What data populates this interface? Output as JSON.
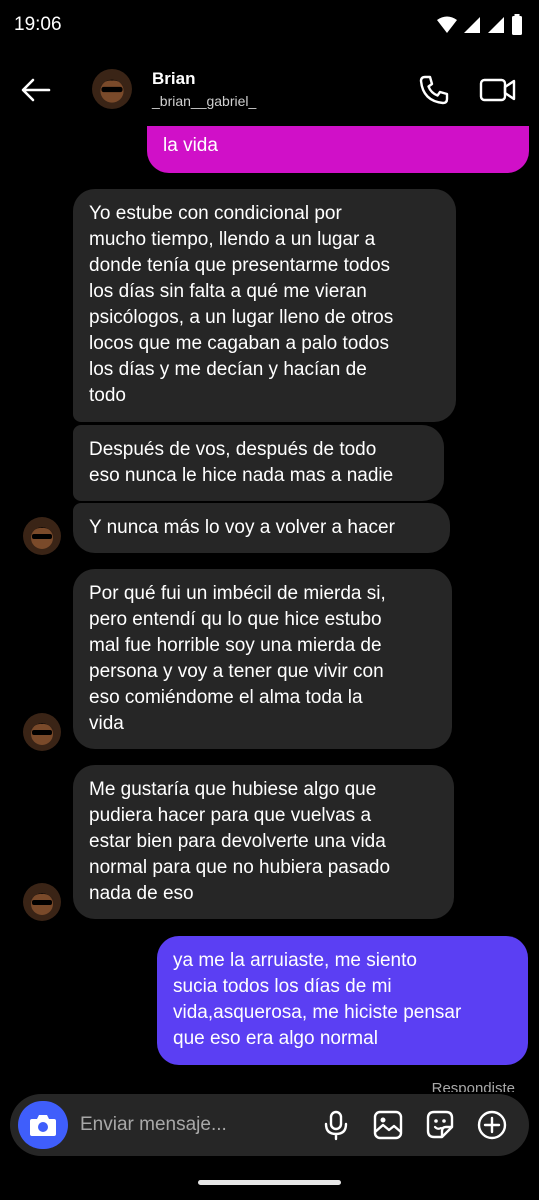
{
  "status_bar": {
    "time": "19:06"
  },
  "header": {
    "name": "Brian",
    "username": "_brian__gabriel_"
  },
  "messages": [
    {
      "id": "m0",
      "direction": "out",
      "text": "en una carcel cuando me traumaste\nla vida",
      "color": "#d010c8"
    },
    {
      "id": "m1",
      "direction": "in",
      "text": "Yo estube con condicional por\nmucho tiempo, llendo a un lugar a\ndonde tenía que presentarme todos\nlos días sin falta a qué me vieran\npsicólogos, a un lugar lleno de otros\nlocos que me cagaban a palo todos\nlos días y me decían y hacían de\ntodo"
    },
    {
      "id": "m2",
      "direction": "in",
      "text": "Después de vos, después de todo\neso nunca le hice nada mas a nadie"
    },
    {
      "id": "m3",
      "direction": "in",
      "text": "Y nunca más lo voy a volver a hacer"
    },
    {
      "id": "m4",
      "direction": "in",
      "text": "Por qué fui un imbécil de mierda si,\npero entendí qu lo que hice estubo\nmal fue horrible soy una mierda de\npersona y voy a tener que vivir con\neso comiéndome el alma toda la\nvida"
    },
    {
      "id": "m5",
      "direction": "in",
      "text": "Me gustaría que hubiese algo que\npudiera hacer para que vuelvas a\nestar bien para devolverte una vida\nnormal para que no hubiera pasado\nnada de eso"
    },
    {
      "id": "m6",
      "direction": "out",
      "text": "ya me la arruiaste, me siento\nsucia todos los días de mi\nvida,asquerosa,  me hiciste pensar\nque eso era algo normal",
      "color": "#5b3ff3"
    }
  ],
  "reply_label": "Respondiste",
  "composer": {
    "placeholder": "Enviar mensaje..."
  },
  "colors": {
    "incoming_bubble": "#262626",
    "outgoing_top": "#d010c8",
    "outgoing_bottom": "#5b3ff3",
    "camera_button": "#3f5efb"
  },
  "icons": [
    "back-arrow-icon",
    "phone-icon",
    "video-camera-icon",
    "camera-icon",
    "microphone-icon",
    "image-icon",
    "sticker-icon",
    "plus-icon"
  ]
}
